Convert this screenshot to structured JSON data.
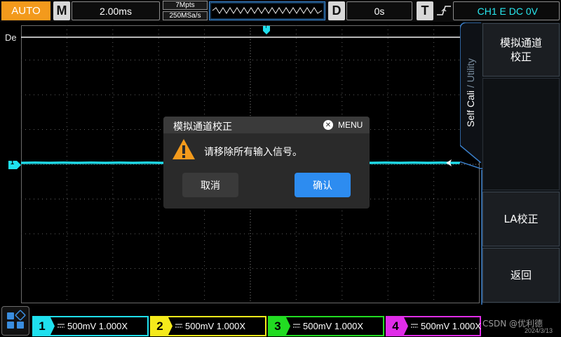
{
  "top_bar": {
    "mode": "AUTO",
    "timebase_label": "M",
    "timebase_value": "2.00ms",
    "memory_depth": "7Mpts",
    "sample_rate": "250MSa/s",
    "delay_label": "D",
    "delay_value": "0s",
    "trigger_label": "T",
    "trigger_info": "CH1 E DC 0V"
  },
  "grid": {
    "digital_label": "De",
    "channel_marker": "1",
    "trigger_marker": "T"
  },
  "side_panel": {
    "tab_title_active": "Self Cali",
    "tab_title_separator": " / ",
    "tab_title_inactive": "Utility",
    "softkeys": [
      {
        "label": "模拟通道\n校正"
      },
      {
        "label": ""
      },
      {
        "label": "LA校正"
      },
      {
        "label": "返回"
      }
    ]
  },
  "dialog": {
    "title": "模拟通道校正",
    "menu_hint": "MENU",
    "message": "请移除所有输入信号。",
    "cancel_label": "取消",
    "confirm_label": "确认"
  },
  "channels": [
    {
      "number": "1",
      "scale": "500mV 1.000X",
      "color": "#1fe0ee"
    },
    {
      "number": "2",
      "scale": "500mV 1.000X",
      "color": "#f5ea1b"
    },
    {
      "number": "3",
      "scale": "500mV 1.000X",
      "color": "#22dc22"
    },
    {
      "number": "4",
      "scale": "500mV 1.000X",
      "color": "#e02ce8"
    }
  ],
  "watermark": "CSDN @优利德",
  "date": "2024/3/13",
  "colors": {
    "auto": "#f39a1c",
    "ch1": "#1fe0ee",
    "confirm": "#2d8cf0",
    "grid": "#5e5e5e"
  }
}
